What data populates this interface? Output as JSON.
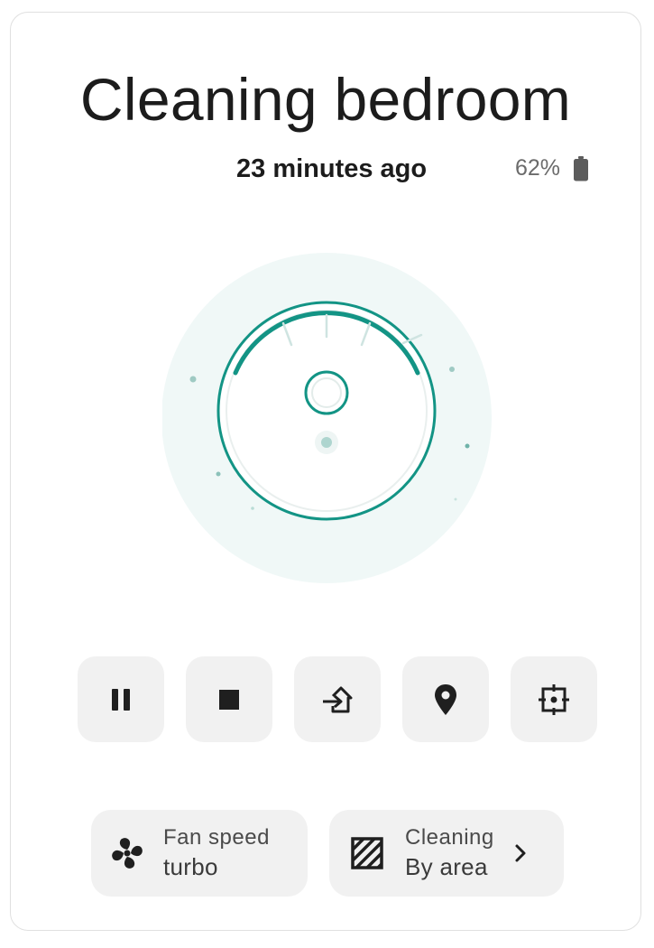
{
  "header": {
    "title": "Cleaning bedroom",
    "last_run": "23 minutes ago",
    "battery": "62%",
    "battery_level": 0.62,
    "battery_icon": "battery-icon"
  },
  "robot": {
    "illustration": "robot-vacuum-icon",
    "accent_color": "#139485",
    "halo_color": "#f0f8f7"
  },
  "controls": [
    {
      "name": "pause",
      "icon": "pause-icon"
    },
    {
      "name": "stop",
      "icon": "stop-icon"
    },
    {
      "name": "return-to-base",
      "icon": "return-home-icon"
    },
    {
      "name": "locate",
      "icon": "map-marker-icon"
    },
    {
      "name": "clean-spot",
      "icon": "spot-clean-icon"
    }
  ],
  "fan_speed": {
    "label": "Fan speed",
    "value": "turbo",
    "icon": "fan-icon"
  },
  "cleaning_mode": {
    "label": "Cleaning",
    "value": "By area",
    "icon": "hatched-square-icon",
    "chevron_icon": "chevron-right-icon"
  }
}
